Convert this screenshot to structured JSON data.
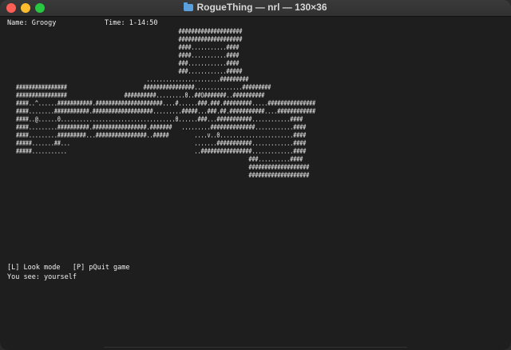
{
  "window": {
    "title": "RogueThing — nrl — 130×36",
    "close_icon": "close-icon",
    "minimize_icon": "minimize-icon",
    "zoom_icon": "zoom-icon",
    "folder_icon": "folder-icon"
  },
  "status": {
    "name": "Name: Groogy",
    "time": "Time: 1-14:50"
  },
  "map": {
    "lines": [
      "                                                        ####################",
      "                                                        ####################",
      "                                                        ####...........####",
      "                                                        ####...........####",
      "                                                        ###............####",
      "                                                        ###............#####",
      "                                              .......................#########",
      "     ################                        ################...............#########",
      "     ################                  ##########.........0..##O#######..##########",
      "     ####..^......###########.#####################....#......###.###.#########.....###############",
      "     ####........###########.###################.........#####...###.##.###########....############",
      "     ####..@......0....................................0......###...###########............####",
      "     ####.........##########.#################.#######   .........##############............####",
      "     ####.........#########...################..#####        ....v..0.......................####",
      "     #####.......##...                                       .......###########.............####",
      "     #####...........                                        ..################.............####",
      "                                                                              ###..........####",
      "                                                                              ###################",
      "                                                                              ###################"
    ]
  },
  "footer": {
    "controls": "[L] Look mode   [P] pQuit game",
    "message": "You see: yourself"
  }
}
